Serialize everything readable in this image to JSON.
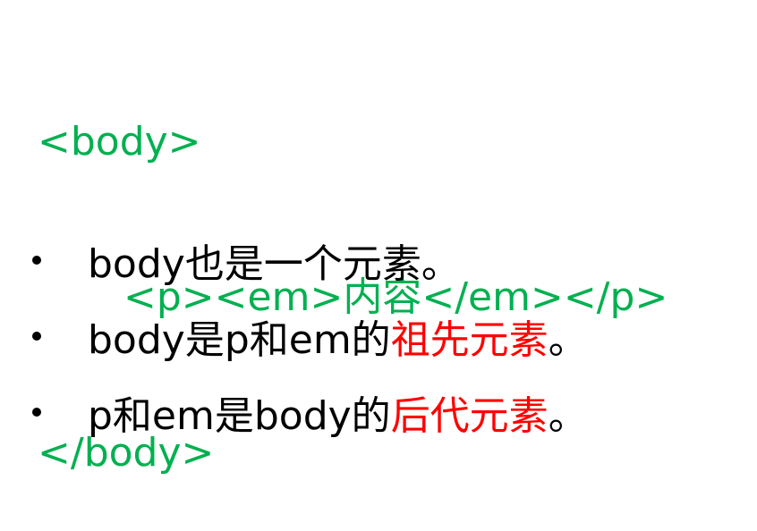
{
  "colors": {
    "code": "#00b050",
    "text": "#000000",
    "highlight": "#ff0000"
  },
  "code": {
    "line1": "<body>",
    "line2": "<p><em>内容</em></p>",
    "line3": "</body>"
  },
  "bullets": [
    {
      "text": "body也是一个元素。"
    },
    {
      "pre": "body是p和em的",
      "highlight": "祖先元素",
      "post": "。"
    },
    {
      "pre": "p和em是body的",
      "highlight": "后代元素",
      "post": "。"
    }
  ]
}
